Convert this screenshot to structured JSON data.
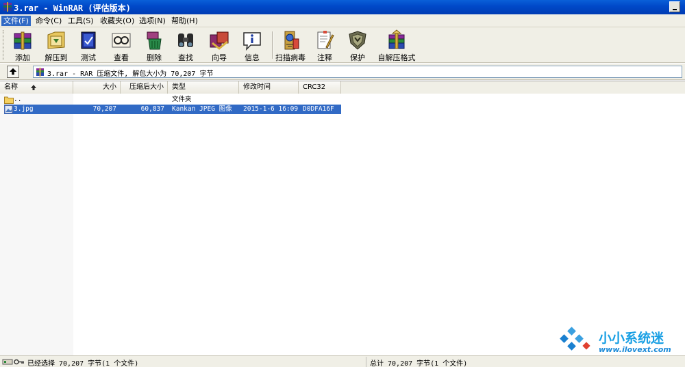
{
  "window": {
    "title": "3.rar - WinRAR (评估版本)"
  },
  "menu": [
    {
      "label": "文件(F)",
      "active": true
    },
    {
      "label": "命令(C)"
    },
    {
      "label": "工具(S)"
    },
    {
      "label": "收藏夹(O)"
    },
    {
      "label": "选项(N)"
    },
    {
      "label": "帮助(H)"
    }
  ],
  "toolbar": [
    {
      "label": "添加",
      "icon": "add-icon"
    },
    {
      "label": "解压到",
      "icon": "extract-to-icon"
    },
    {
      "label": "测试",
      "icon": "test-icon"
    },
    {
      "label": "查看",
      "icon": "view-icon"
    },
    {
      "label": "删除",
      "icon": "delete-icon"
    },
    {
      "label": "查找",
      "icon": "find-icon"
    },
    {
      "label": "向导",
      "icon": "wizard-icon"
    },
    {
      "label": "信息",
      "icon": "info-icon"
    },
    {
      "label": "扫描病毒",
      "icon": "virus-scan-icon"
    },
    {
      "label": "注释",
      "icon": "comment-icon"
    },
    {
      "label": "保护",
      "icon": "protect-icon"
    },
    {
      "label": "自解压格式",
      "icon": "sfx-icon"
    }
  ],
  "address": {
    "text": "3.rar - RAR 压缩文件, 解包大小为 70,207 字节"
  },
  "columns": {
    "name": "名称",
    "size": "大小",
    "packed": "压缩后大小",
    "type": "类型",
    "modified": "修改时间",
    "crc": "CRC32"
  },
  "rows": [
    {
      "name": "..",
      "size": "",
      "packed": "",
      "type": "文件夹",
      "modified": "",
      "crc": "",
      "icon": "folder-icon"
    },
    {
      "name": "3.jpg",
      "size": "70,207",
      "packed": "60,837",
      "type": "Kankan JPEG 图像",
      "modified": "2015-1-6 16:09",
      "crc": "D0DFA16F",
      "icon": "image-file-icon",
      "selected": true
    }
  ],
  "status": {
    "left": "已经选择 70,207 字节(1 个文件)",
    "right": "总计 70,207 字节(1 个文件)"
  },
  "watermark": {
    "title": "小小系统迷",
    "url": "www.ilovext.com"
  },
  "colors": {
    "titlebar": "#0048c8",
    "selection": "#316ac5",
    "chrome": "#f0efe6",
    "watermark": "#1aa0e4"
  }
}
